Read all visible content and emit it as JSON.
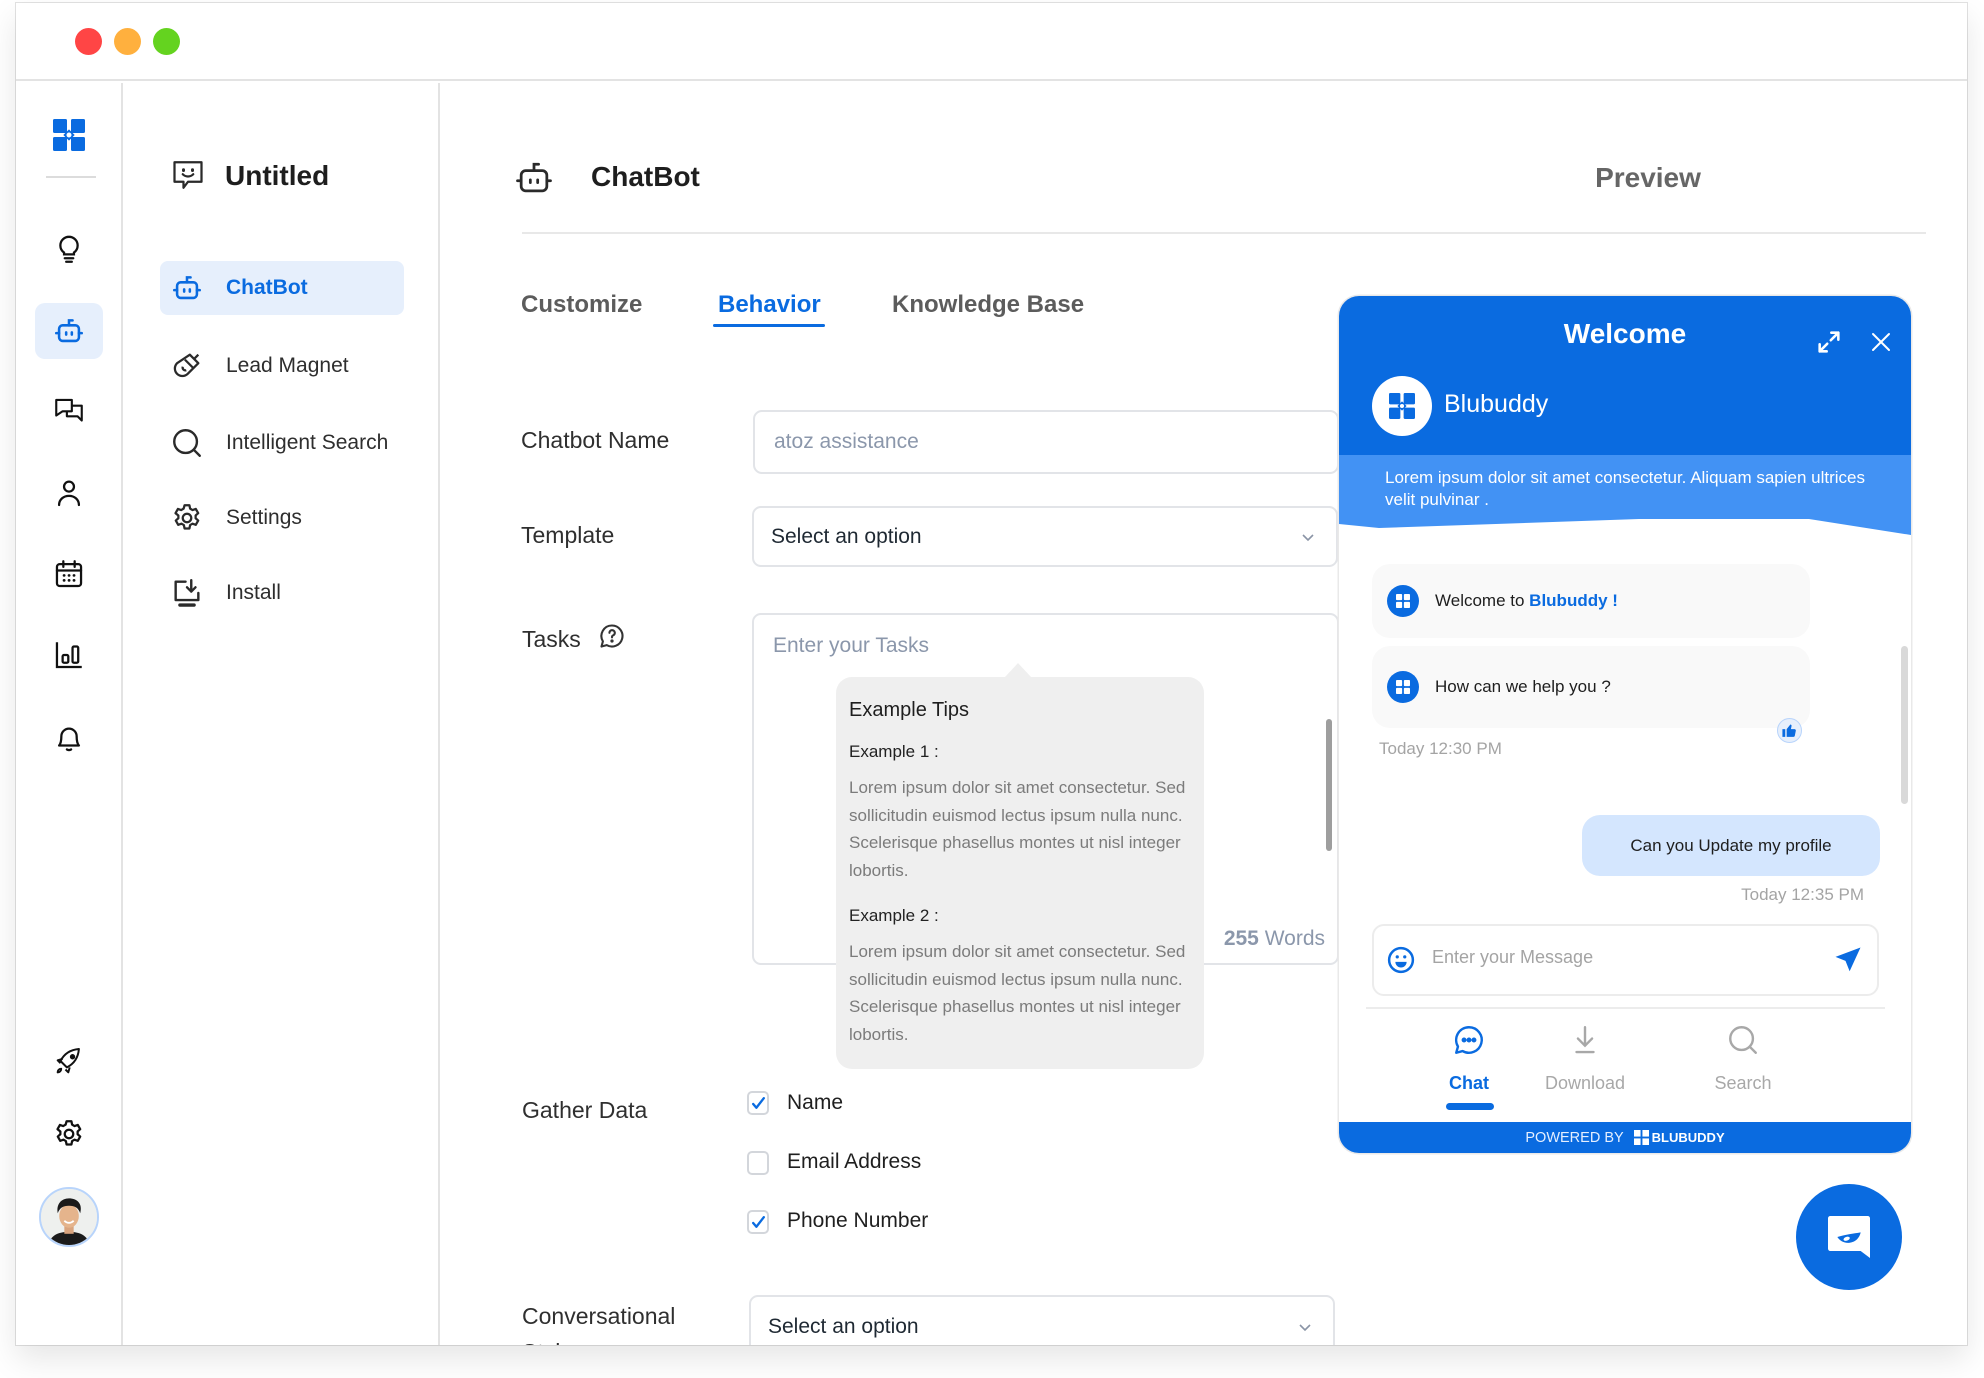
{
  "window": {
    "controls": [
      "close",
      "minimize",
      "maximize"
    ]
  },
  "colors": {
    "brand": "#0a6be0",
    "brand_light": "#4292f4",
    "active_bg": "#e6effc",
    "close": "#ff4545",
    "minimize": "#ffb03e",
    "maximize": "#64d31f"
  },
  "rail": {
    "logo": "blubuddy-logo",
    "items": [
      {
        "icon": "lightbulb-icon",
        "active": false
      },
      {
        "icon": "robot-icon",
        "active": true
      },
      {
        "icon": "chat-bubbles-icon",
        "active": false
      },
      {
        "icon": "user-icon",
        "active": false
      },
      {
        "icon": "calendar-icon",
        "active": false
      },
      {
        "icon": "bar-chart-icon",
        "active": false
      },
      {
        "icon": "bell-icon",
        "active": false
      }
    ],
    "bottom": [
      {
        "icon": "rocket-icon"
      },
      {
        "icon": "gear-icon"
      },
      {
        "icon": "avatar"
      }
    ]
  },
  "nav": {
    "title": "Untitled",
    "items": [
      {
        "label": "ChatBot",
        "icon": "robot-icon",
        "active": true
      },
      {
        "label": "Lead Magnet",
        "icon": "magnet-icon",
        "active": false
      },
      {
        "label": "Intelligent Search",
        "icon": "search-icon",
        "active": false
      },
      {
        "label": "Settings",
        "icon": "gear-icon",
        "active": false
      },
      {
        "label": "Install",
        "icon": "install-icon",
        "active": false
      }
    ]
  },
  "header": {
    "title": "ChatBot",
    "preview": "Preview"
  },
  "tabs": [
    {
      "label": "Customize",
      "active": false
    },
    {
      "label": "Behavior",
      "active": true
    },
    {
      "label": "Knowledge Base",
      "active": false
    }
  ],
  "form": {
    "chatbot_name": {
      "label": "Chatbot Name",
      "placeholder": "atoz assistance",
      "value": ""
    },
    "template": {
      "label": "Template",
      "value": "Select an option"
    },
    "tasks": {
      "label": "Tasks",
      "placeholder": "Enter your Tasks",
      "word_count": "255",
      "word_label": "Words"
    },
    "gather_data": {
      "label": "Gather Data",
      "options": [
        {
          "label": "Name",
          "checked": true
        },
        {
          "label": "Email Address",
          "checked": false
        },
        {
          "label": "Phone Number",
          "checked": true
        }
      ]
    },
    "conversational_style": {
      "label": "Conversational Style",
      "value": "Select an option"
    }
  },
  "tooltip": {
    "title": "Example Tips",
    "examples": [
      {
        "label": "Example 1 :",
        "text": "Lorem ipsum dolor sit amet consectetur. Sed sollicitudin euismod lectus ipsum nulla nunc. Scelerisque phasellus montes ut nisl integer lobortis."
      },
      {
        "label": "Example 2 :",
        "text": "Lorem ipsum dolor sit amet consectetur. Sed sollicitudin euismod lectus ipsum nulla nunc. Scelerisque phasellus montes ut nisl integer lobortis."
      }
    ]
  },
  "widget": {
    "title": "Welcome",
    "bot_name": "Blubuddy",
    "intro": "Lorem ipsum dolor sit amet consectetur. Aliquam sapien ultrices velit pulvinar .",
    "messages": [
      {
        "from": "bot",
        "prefix": "Welcome to ",
        "highlight": "Blubuddy !"
      },
      {
        "from": "bot",
        "text": "How can we help you ?"
      }
    ],
    "bot_time": "Today 12:30 PM",
    "user_message": "Can you Update my profile",
    "user_time": "Today 12:35 PM",
    "input_placeholder": "Enter your Message",
    "tabs": [
      {
        "label": "Chat",
        "active": true
      },
      {
        "label": "Download",
        "active": false
      },
      {
        "label": "Search",
        "active": false
      }
    ],
    "powered_by": "POWERED BY",
    "powered_brand": "BLUBUDDY"
  }
}
